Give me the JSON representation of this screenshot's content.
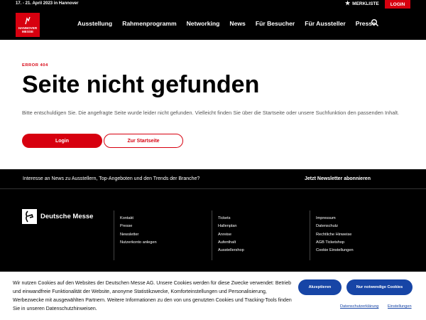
{
  "topbar": {
    "event_date": "17. - 21. April 2023 in Hannover",
    "merkliste_label": "MERKLISTE",
    "login_label": "LOGIN"
  },
  "logo": {
    "line1": "HANNOVER",
    "line2": "MESSE"
  },
  "nav": {
    "items": [
      {
        "label": "Ausstellung"
      },
      {
        "label": "Rahmenprogramm"
      },
      {
        "label": "Networking"
      },
      {
        "label": "News"
      },
      {
        "label": "Für Besucher"
      },
      {
        "label": "Für Aussteller"
      },
      {
        "label": "Presse"
      }
    ],
    "search_icon": "search-icon"
  },
  "error": {
    "label": "ERROR 404",
    "title": "Seite nicht gefunden",
    "text": "Bitte entschuldigen Sie. Die angefragte Seite wurde leider nicht gefunden. Vielleicht finden Sie über die Startseite oder unsere Suchfunktion den passenden Inhalt.",
    "login_button": "Login",
    "start_button": "Zur Startseite"
  },
  "newsletter": {
    "text": "Interesse an News zu Ausstellern, Top-Angeboten und den Trends der Branche?",
    "link": "Jetzt Newsletter abonnieren"
  },
  "footer": {
    "brand": "Deutsche Messe",
    "col1": [
      "Kontakt",
      "Presse",
      "Newsletter",
      "Nutzerkonto anlegen"
    ],
    "col2": [
      "Tickets",
      "Hallenplan",
      "Anreise",
      "Aufenthalt",
      "Ausstellershop"
    ],
    "col3": [
      "Impressum",
      "Datenschutz",
      "Rechtliche Hinweise",
      "AGB Ticketshop",
      "Cookie Einstellungen"
    ]
  },
  "cookie": {
    "text": "Wir nutzen Cookies auf den Websites der Deutschen Messe AG. Unsere Cookies werden für diese Zwecke verwendet: Betrieb und einwandfreie Funktionalität der Website, anonyme Statistikzwecke, Komforteinstellungen und Personalisierung, Werbezwecke mit ausgewählten Partnern. Weitere Informationen zu den von uns genutzten Cookies und Tracking-Tools finden Sie in unseren Datenschutzhinweisen.",
    "accept": "Akzeptieren",
    "necessary": "Nur notwendige Cookies",
    "privacy_link": "Datenschutzerklärung",
    "settings_link": "Einstellungen"
  },
  "colors": {
    "brand_red": "#d7000f",
    "cookie_blue": "#1745a6",
    "header_bg": "#000000"
  }
}
